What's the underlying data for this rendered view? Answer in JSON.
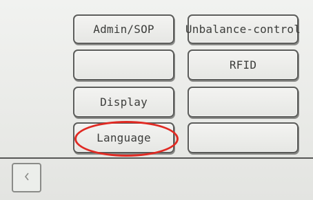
{
  "menu": {
    "left": [
      "Admin/SOP",
      "",
      "Display",
      "Language"
    ],
    "right": [
      "Unbalance-control",
      "RFID",
      "",
      ""
    ]
  },
  "footer": {
    "back_glyph": "<"
  },
  "annotation": {
    "highlighted_item": "Language",
    "color": "#e02a23"
  },
  "icons": {
    "back": "chevron-left-icon"
  }
}
